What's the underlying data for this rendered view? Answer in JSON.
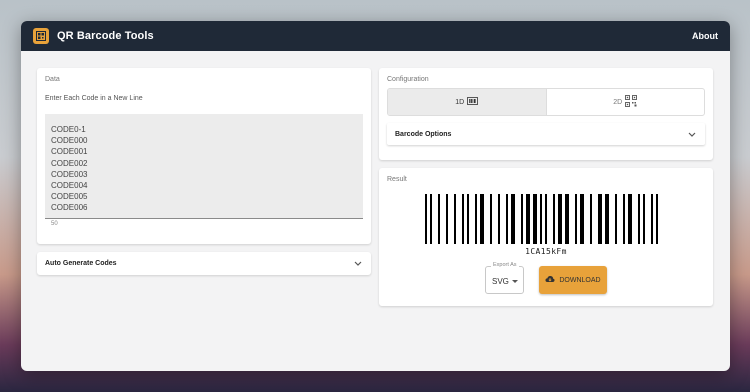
{
  "app": {
    "title": "QR Barcode Tools",
    "about_label": "About"
  },
  "data_panel": {
    "heading": "Data",
    "instruction": "Enter Each Code in a New Line",
    "codes": [
      "CODE0-1",
      "CODE000",
      "CODE001",
      "CODE002",
      "CODE003",
      "CODE004",
      "CODE005",
      "CODE006"
    ],
    "char_count": "50"
  },
  "auto_generate": {
    "label": "Auto Generate Codes"
  },
  "configuration": {
    "heading": "Configuration",
    "toggle_1d": "1D",
    "toggle_2d": "2D",
    "active": "1D",
    "barcode_options_label": "Barcode Options"
  },
  "result": {
    "heading": "Result",
    "barcode_value": "1CA15kFm",
    "export_as_label": "Export As",
    "export_format": "SVG",
    "download_label": "DOWNLOAD"
  },
  "colors": {
    "appbar": "#1f2937",
    "accent": "#e8a23a"
  },
  "icons": [
    "barcode-icon",
    "qr-code-icon",
    "chevron-down-icon",
    "cloud-download-icon",
    "app-logo-icon"
  ]
}
